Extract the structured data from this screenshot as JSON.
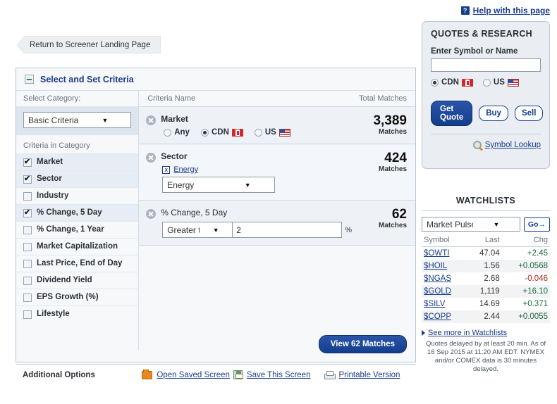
{
  "help": {
    "icon": "question-mark-icon",
    "label": "Help with this page"
  },
  "return_tab": {
    "label": "Return to Screener Landing Page"
  },
  "screener": {
    "title": "Select and Set Criteria",
    "collapse_icon": "minus-icon",
    "left": {
      "select_category_label": "Select Category:",
      "category_value": "Basic Criteria",
      "criteria_in_category_label": "Criteria in Category",
      "items": [
        {
          "label": "Market",
          "checked": true
        },
        {
          "label": "Sector",
          "checked": true
        },
        {
          "label": "Industry",
          "checked": false
        },
        {
          "label": "% Change, 5 Day",
          "checked": true
        },
        {
          "label": "% Change, 1 Year",
          "checked": false
        },
        {
          "label": "Market Capitalization",
          "checked": false
        },
        {
          "label": "Last Price, End of Day",
          "checked": false
        },
        {
          "label": "Dividend Yield",
          "checked": false
        },
        {
          "label": "EPS Growth (%)",
          "checked": false
        },
        {
          "label": "Lifestyle",
          "checked": false
        }
      ]
    },
    "criteria_header": {
      "name": "Criteria Name",
      "matches": "Total Matches"
    },
    "rows": {
      "market": {
        "name": "Market",
        "count": "3,389",
        "count_label": "Matches",
        "options": [
          {
            "label": "Any",
            "selected": false
          },
          {
            "label": "CDN",
            "selected": true,
            "flag": "canada-flag"
          },
          {
            "label": "US",
            "selected": false,
            "flag": "usa-flag"
          }
        ]
      },
      "sector": {
        "name": "Sector",
        "count": "424",
        "count_label": "Matches",
        "tag": "Energy",
        "tag_remove": "x",
        "select_value": "Energy"
      },
      "change5d": {
        "name": "% Change, 5 Day",
        "count": "62",
        "count_label": "Matches",
        "operator": "Greater than...",
        "value": "2",
        "unit": "%"
      }
    },
    "view_button": "View 62 Matches"
  },
  "additional": {
    "label": "Additional Options",
    "items": [
      {
        "label": "Open Saved Screen",
        "icon": "folder-icon"
      },
      {
        "label": "Save This Screen",
        "icon": "floppy-disk-icon"
      },
      {
        "label": "Printable Version",
        "icon": "printer-icon"
      }
    ]
  },
  "quotes": {
    "title": "QUOTES & RESEARCH",
    "symbol_label": "Enter Symbol or Name",
    "symbol_value": "",
    "symbol_placeholder": "",
    "markets": [
      {
        "label": "CDN",
        "selected": true,
        "flag": "canada-flag"
      },
      {
        "label": "US",
        "selected": false,
        "flag": "usa-flag"
      }
    ],
    "get_quote": "Get Quote",
    "buy": "Buy",
    "sell": "Sell",
    "lookup": "Symbol Lookup",
    "lookup_icon": "magnifier-icon"
  },
  "watchlists": {
    "title": "WATCHLISTS",
    "select_value": "Market Pulse",
    "go": "Go",
    "columns": {
      "symbol": "Symbol",
      "last": "Last",
      "chg": "Chg"
    },
    "rows": [
      {
        "symbol": "$OWTI",
        "last": "47.04",
        "chg": "+2.45",
        "dir": "up"
      },
      {
        "symbol": "$HOIL",
        "last": "1.56",
        "chg": "+0.0568",
        "dir": "up"
      },
      {
        "symbol": "$NGAS",
        "last": "2.68",
        "chg": "-0.046",
        "dir": "down"
      },
      {
        "symbol": "$GOLD",
        "last": "1,119",
        "chg": "+16.10",
        "dir": "up"
      },
      {
        "symbol": "$SILV",
        "last": "14.69",
        "chg": "+0.371",
        "dir": "up"
      },
      {
        "symbol": "$COPP",
        "last": "2.44",
        "chg": "+0.0055",
        "dir": "up"
      }
    ],
    "see_more": "See more in Watchlists",
    "disclaimer": "Quotes delayed by at least 20 min.  As of 16 Sep 2015 at 11:20 AM EDT.  NYMEX and/or COMEX data is 30 minutes delayed."
  },
  "colors": {
    "accent": "#123f8c",
    "link": "#1a3c8c",
    "up": "#1f6b3a",
    "down": "#b3261e"
  }
}
